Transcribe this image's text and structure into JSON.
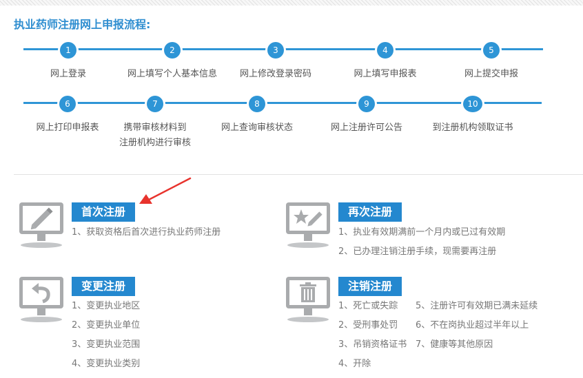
{
  "page_title": "执业药师注册网上申报流程:",
  "steps": [
    {
      "num": "1",
      "label": "网上登录"
    },
    {
      "num": "2",
      "label": "网上填写个人基本信息"
    },
    {
      "num": "3",
      "label": "网上修改登录密码"
    },
    {
      "num": "4",
      "label": "网上填写申报表"
    },
    {
      "num": "5",
      "label": "网上提交申报"
    },
    {
      "num": "6",
      "label": "网上打印申报表"
    },
    {
      "num": "7",
      "label_line1": "携带审核材料到",
      "label_line2": "注册机构进行审核"
    },
    {
      "num": "8",
      "label": "网上查询审核状态"
    },
    {
      "num": "9",
      "label": "网上注册许可公告"
    },
    {
      "num": "10",
      "label": "到注册机构领取证书"
    }
  ],
  "registrations": {
    "first": {
      "title": "首次注册",
      "icon": "monitor-pen-icon",
      "items": [
        "1、获取资格后首次进行执业药师注册"
      ]
    },
    "again": {
      "title": "再次注册",
      "icon": "monitor-star-icon",
      "items": [
        "1、执业有效期满前一个月内或已过有效期",
        "2、已办理注销注册手续，现需要再注册"
      ]
    },
    "change": {
      "title": "变更注册",
      "icon": "monitor-undo-icon",
      "items": [
        "1、变更执业地区",
        "2、变更执业单位",
        "3、变更执业范围",
        "4、变更执业类别"
      ]
    },
    "cancel": {
      "title": "注销注册",
      "icon": "monitor-trash-icon",
      "items_col1": [
        "1、死亡或失踪",
        "2、受刑事处罚",
        "3、吊销资格证书",
        "4、开除"
      ],
      "items_col2": [
        "5、注册许可有效期已满未延续",
        "6、不在岗执业超过半年以上",
        "7、健康等其他原因"
      ]
    }
  },
  "colors": {
    "accent": "#2e95d6",
    "title_bg": "#2488cf",
    "arrow": "#e8332d",
    "icon": "#a9abad"
  }
}
